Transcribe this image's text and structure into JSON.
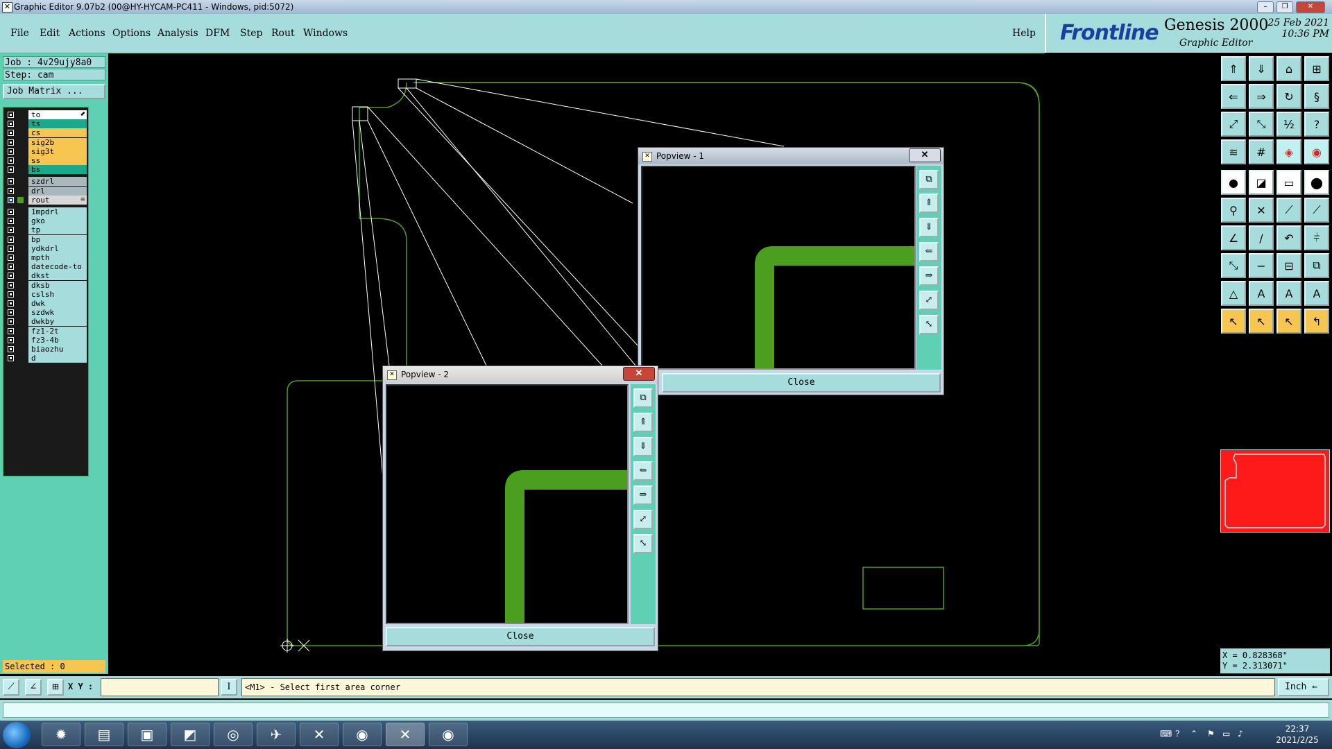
{
  "window": {
    "title": "Graphic Editor 9.07b2 (00@HY-HYCAM-PC411 - Windows, pid:5072)",
    "minimize_glyph": "–",
    "restore_glyph": "❐",
    "close_glyph": "✕"
  },
  "menu": {
    "items": [
      "File",
      "Edit",
      "Actions",
      "Options",
      "Analysis",
      "DFM",
      "Step",
      "Rout",
      "Windows"
    ],
    "help": "Help"
  },
  "brand": {
    "logo": "Frontline",
    "product": "Genesis 2000",
    "subtitle": "Graphic Editor",
    "date": "25 Feb 2021",
    "time": "10:36 PM"
  },
  "job": {
    "job_label": "Job : 4v29ujy8a0",
    "step_label": "Step: cam",
    "matrix_button": "Job Matrix ..."
  },
  "layers": [
    {
      "name": "to",
      "color": "#ffffff",
      "mark": "⬋"
    },
    {
      "name": "ts",
      "color": "#1aa98a",
      "mark": ""
    },
    {
      "name": "cs",
      "color": "#f7c650",
      "mark": ""
    },
    {
      "name": "sig2b",
      "color": "#f7c650",
      "mark": ""
    },
    {
      "name": "sig3t",
      "color": "#f7c650",
      "mark": ""
    },
    {
      "name": "ss",
      "color": "#f7c650",
      "mark": ""
    },
    {
      "name": "bs",
      "color": "#1aa98a",
      "mark": ""
    },
    {
      "name": "szdrl",
      "color": "#a8b8bc",
      "mark": ""
    },
    {
      "name": "drl",
      "color": "#a8b8bc",
      "mark": ""
    },
    {
      "name": "rout",
      "color": "#d8d8d8",
      "mark": "≡"
    },
    {
      "name": "1mpdrl",
      "color": "#a6dcdc",
      "mark": ""
    },
    {
      "name": "gko",
      "color": "#a6dcdc",
      "mark": ""
    },
    {
      "name": "tp",
      "color": "#a6dcdc",
      "mark": ""
    },
    {
      "name": "bp",
      "color": "#a6dcdc",
      "mark": ""
    },
    {
      "name": "ydkdrl",
      "color": "#a6dcdc",
      "mark": ""
    },
    {
      "name": "mpth",
      "color": "#a6dcdc",
      "mark": ""
    },
    {
      "name": "datecode-to",
      "color": "#a6dcdc",
      "mark": ""
    },
    {
      "name": "dkst",
      "color": "#a6dcdc",
      "mark": ""
    },
    {
      "name": "dksb",
      "color": "#a6dcdc",
      "mark": ""
    },
    {
      "name": "cslsh",
      "color": "#a6dcdc",
      "mark": ""
    },
    {
      "name": "dwk",
      "color": "#a6dcdc",
      "mark": ""
    },
    {
      "name": "szdwk",
      "color": "#a6dcdc",
      "mark": ""
    },
    {
      "name": "dwkby",
      "color": "#a6dcdc",
      "mark": ""
    },
    {
      "name": "fz1-2t",
      "color": "#a6dcdc",
      "mark": ""
    },
    {
      "name": "fz3-4b",
      "color": "#a6dcdc",
      "mark": ""
    },
    {
      "name": "biaozhu",
      "color": "#a6dcdc",
      "mark": ""
    },
    {
      "name": "d",
      "color": "#a6dcdc",
      "mark": ""
    }
  ],
  "selected": "Selected : 0",
  "popview1": {
    "title": "Popview - 1",
    "close_button": "Close"
  },
  "popview2": {
    "title": "Popview - 2",
    "close_button": "Close"
  },
  "coordinates": {
    "x": "X = 0.828368\"",
    "y": "Y = 2.313071\""
  },
  "status": {
    "xy_label": "X Y :",
    "xy_value": "",
    "prompt": "<M1> - Select first area corner",
    "units": "Inch ⇐"
  },
  "taskbar": {
    "time": "22:37",
    "date": "2021/2/25"
  }
}
